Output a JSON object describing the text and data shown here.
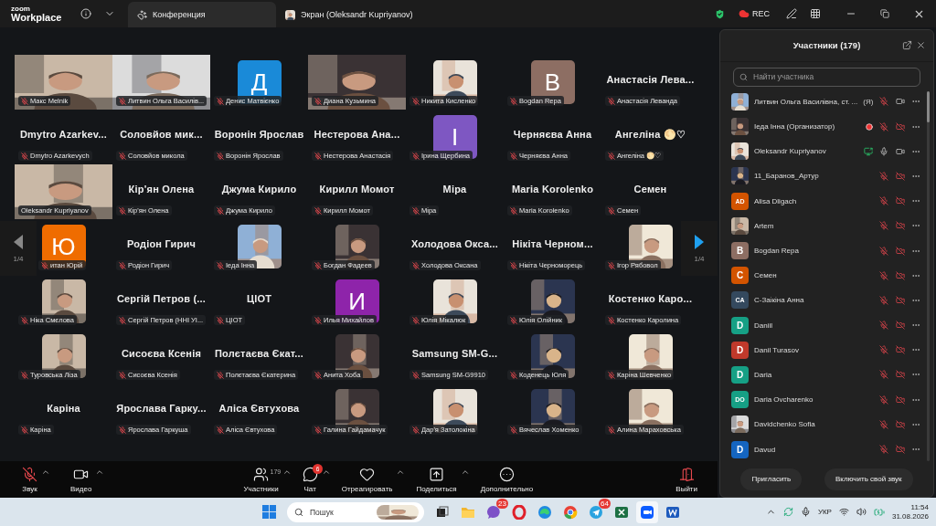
{
  "titlebar": {
    "logo_top": "zoom",
    "logo_bottom": "Workplace",
    "rec": "REC",
    "tabs": [
      {
        "label": "Конференция",
        "kind": "meeting",
        "selected": true
      },
      {
        "label": "Экран (Oleksandr Kupriyanov)",
        "kind": "screen",
        "selected": false
      }
    ]
  },
  "gallery": {
    "page_left": "1/4",
    "page_right": "1/4",
    "tiles": [
      {
        "kind": "video_full",
        "name": "Макс Melnik",
        "muted": true,
        "speaking": false
      },
      {
        "kind": "video_full",
        "name": "Литвин Ольга Василів...",
        "muted": true,
        "speaking": false
      },
      {
        "kind": "avatar",
        "letter": "Д",
        "color": "#1a8ad8",
        "name": "Денис Матвієнко",
        "muted": true,
        "speaking": false
      },
      {
        "kind": "video_full",
        "name": "Диана Кузьмина",
        "muted": true,
        "speaking": false
      },
      {
        "kind": "video",
        "name": "Никита Кисленко",
        "muted": true,
        "speaking": false
      },
      {
        "kind": "avatar",
        "letter": "B",
        "color": "#8d6e63",
        "name": "Bogdan Repa",
        "muted": true,
        "speaking": false
      },
      {
        "kind": "name",
        "title": "Анастасія Лева...",
        "name": "Анастасія Леванда",
        "muted": true,
        "speaking": false
      },
      {
        "kind": "name",
        "title": "Dmytro Azarkev...",
        "name": "Dmytro Azarkevych",
        "muted": true,
        "speaking": false
      },
      {
        "kind": "name",
        "title": "Соловйов мик...",
        "name": "Соловйов микола",
        "muted": true,
        "speaking": false
      },
      {
        "kind": "name",
        "title": "Воронін Ярослав",
        "name": "Воронін Ярослав",
        "muted": true,
        "speaking": false
      },
      {
        "kind": "name",
        "title": "Нестерова Ана...",
        "name": "Нестерова Анастасія",
        "muted": true,
        "speaking": false
      },
      {
        "kind": "avatar",
        "letter": "I",
        "color": "#7e57c2",
        "name": "Ірина Щербина",
        "muted": true,
        "speaking": false
      },
      {
        "kind": "name",
        "title": "Черняєва Анна",
        "name": "Черняєва Анна",
        "muted": true,
        "speaking": false
      },
      {
        "kind": "name",
        "title": "Ангеліна 🌕♡",
        "name": "Ангеліна 🌕♡",
        "muted": true,
        "speaking": false
      },
      {
        "kind": "video_full",
        "name": "Oleksandr Kupriyanov",
        "muted": false,
        "speaking": true
      },
      {
        "kind": "name",
        "title": "Кір'ян Олена",
        "name": "Кір'ян Олена",
        "muted": true,
        "speaking": false
      },
      {
        "kind": "name",
        "title": "Джума Кирило",
        "name": "Джума Кирило",
        "muted": true,
        "speaking": false
      },
      {
        "kind": "name",
        "title": "Кирилл Момот",
        "name": "Кирилл Момот",
        "muted": true,
        "speaking": false
      },
      {
        "kind": "name",
        "title": "Міра",
        "name": "Міра",
        "muted": true,
        "speaking": false
      },
      {
        "kind": "name",
        "title": "Maria Korolenko",
        "name": "Maria Korolenko",
        "muted": true,
        "speaking": false
      },
      {
        "kind": "name",
        "title": "Семен",
        "name": "Семен",
        "muted": true,
        "speaking": false
      },
      {
        "kind": "avatar",
        "letter": "Ю",
        "color": "#ef6c00",
        "name": "итан Юрій",
        "muted": true,
        "speaking": false
      },
      {
        "kind": "name",
        "title": "Родіон Гирич",
        "name": "Родіон Гирич",
        "muted": true,
        "speaking": false
      },
      {
        "kind": "video",
        "name": "Іеда Інна",
        "muted": true,
        "speaking": false
      },
      {
        "kind": "video",
        "name": "Богдан Фадеев",
        "muted": true,
        "speaking": false
      },
      {
        "kind": "name",
        "title": "Холодова Окса...",
        "name": "Холодова Оксана",
        "muted": true,
        "speaking": false
      },
      {
        "kind": "name",
        "title": "Нікіта Черном...",
        "name": "Нікіта Черноморець",
        "muted": true,
        "speaking": false
      },
      {
        "kind": "video",
        "name": "Ігор Рябовол",
        "muted": true,
        "speaking": false
      },
      {
        "kind": "video",
        "name": "Ніка Смєлова",
        "muted": true,
        "speaking": false
      },
      {
        "kind": "name",
        "title": "Сергій Петров (...",
        "name": "Сергій Петров (ННІ УІ...",
        "muted": true,
        "speaking": false
      },
      {
        "kind": "name",
        "title": "ЦІОТ",
        "name": "ЦІОТ",
        "muted": true,
        "speaking": false
      },
      {
        "kind": "avatar",
        "letter": "И",
        "color": "#8e24aa",
        "name": "Илья Михайлов",
        "muted": true,
        "speaking": false
      },
      {
        "kind": "video",
        "name": "Юлія Мікалюк",
        "muted": true,
        "speaking": false
      },
      {
        "kind": "video",
        "name": "Юлія Олійник",
        "muted": true,
        "speaking": false
      },
      {
        "kind": "name",
        "title": "Костенко Каро...",
        "name": "Костенко Каролина",
        "muted": true,
        "speaking": false
      },
      {
        "kind": "video",
        "name": "Туровська Ліза",
        "muted": true,
        "speaking": false
      },
      {
        "kind": "name",
        "title": "Сисоєва Ксенія",
        "name": "Сисоєва Ксенія",
        "muted": true,
        "speaking": false
      },
      {
        "kind": "name",
        "title": "Полєтаєва Єкат...",
        "name": "Полєтаєва Єкатерина",
        "muted": true,
        "speaking": false
      },
      {
        "kind": "video",
        "name": "Анита Хоба",
        "muted": true,
        "speaking": false
      },
      {
        "kind": "name",
        "title": "Samsung SM-G...",
        "name": "Samsung SM-G9910",
        "muted": true,
        "speaking": false
      },
      {
        "kind": "video",
        "name": "Коденець Юля",
        "muted": true,
        "speaking": false
      },
      {
        "kind": "video",
        "name": "Каріна Шевченко",
        "muted": true,
        "speaking": false
      },
      {
        "kind": "name",
        "title": "Каріна",
        "name": "Каріна",
        "muted": true,
        "speaking": false
      },
      {
        "kind": "name",
        "title": "Ярослава Гарку...",
        "name": "Ярослава Гаркуша",
        "muted": true,
        "speaking": false
      },
      {
        "kind": "name",
        "title": "Аліса Євтухова",
        "name": "Аліса Євтухова",
        "muted": true,
        "speaking": false
      },
      {
        "kind": "video",
        "name": "Галина Гайдамачук",
        "muted": true,
        "speaking": false
      },
      {
        "kind": "video",
        "name": "Дар'я Затолокіна",
        "muted": true,
        "speaking": false
      },
      {
        "kind": "video",
        "name": "Вячеслав Хоменко",
        "muted": true,
        "speaking": false
      },
      {
        "kind": "video",
        "name": "Алина Мараховська",
        "muted": true,
        "speaking": false
      }
    ]
  },
  "participants": {
    "title": "Участники (179)",
    "search": {
      "placeholder": "Найти участника"
    },
    "rows": [
      {
        "name": "Литвин Ольга Василівна, ст. ...",
        "tag": "(Я)",
        "recording": false,
        "sharing": false,
        "mic_muted": true,
        "camera_off": false
      },
      {
        "name": "Іеда Інна (Организатор)",
        "recording": true,
        "sharing": false,
        "mic_muted": true,
        "camera_off": true
      },
      {
        "name": "Oleksandr Kupriyanov",
        "recording": false,
        "sharing": true,
        "mic_muted": false,
        "camera_off": false
      },
      {
        "name": "11_Баранов_Артур",
        "recording": false,
        "sharing": false,
        "mic_muted": true,
        "camera_off": true
      },
      {
        "avatar": {
          "kind": "initials",
          "text": "AD",
          "color": "#d35400"
        },
        "name": "Alisa Dligach",
        "recording": false,
        "sharing": false,
        "mic_muted": true,
        "camera_off": true
      },
      {
        "name": "Artem",
        "recording": false,
        "sharing": false,
        "mic_muted": true,
        "camera_off": true
      },
      {
        "avatar": {
          "kind": "initials",
          "text": "B",
          "color": "#8d6e63"
        },
        "name": "Bogdan Repa",
        "recording": false,
        "sharing": false,
        "mic_muted": true,
        "camera_off": true
      },
      {
        "avatar": {
          "kind": "initials",
          "text": "С",
          "color": "#d35400"
        },
        "name": "Семен",
        "recording": false,
        "sharing": false,
        "mic_muted": true,
        "camera_off": true
      },
      {
        "avatar": {
          "kind": "initials",
          "text": "CA",
          "color": "#34495e"
        },
        "name": "С-Заікіна Анна",
        "recording": false,
        "sharing": false,
        "mic_muted": true,
        "camera_off": true
      },
      {
        "avatar": {
          "kind": "initials",
          "text": "D",
          "color": "#16a085"
        },
        "name": "Daniil",
        "recording": false,
        "sharing": false,
        "mic_muted": true,
        "camera_off": true
      },
      {
        "avatar": {
          "kind": "initials",
          "text": "D",
          "color": "#c0392b"
        },
        "name": "Danil Turasov",
        "recording": false,
        "sharing": false,
        "mic_muted": true,
        "camera_off": true
      },
      {
        "avatar": {
          "kind": "initials",
          "text": "D",
          "color": "#16a085"
        },
        "name": "Daria",
        "recording": false,
        "sharing": false,
        "mic_muted": true,
        "camera_off": true
      },
      {
        "avatar": {
          "kind": "initials",
          "text": "DO",
          "color": "#16a085"
        },
        "name": "Daria Ovcharenko",
        "recording": false,
        "sharing": false,
        "mic_muted": true,
        "camera_off": true
      },
      {
        "name": "Davidchenko Sofia",
        "recording": false,
        "sharing": false,
        "mic_muted": true,
        "camera_off": true
      },
      {
        "avatar": {
          "kind": "initials",
          "text": "D",
          "color": "#1565c0"
        },
        "name": "Davud",
        "recording": false,
        "sharing": false,
        "mic_muted": true,
        "camera_off": true
      }
    ],
    "buttons": [
      "Пригласить",
      "Включить свой звук"
    ]
  },
  "toolbar": {
    "items": [
      {
        "kind": "audio",
        "label": "Звук",
        "muted": true,
        "caret": true
      },
      {
        "kind": "video",
        "label": "Видео",
        "caret": true
      },
      {
        "kind": "participants",
        "label": "Участники",
        "count": "179",
        "caret": true
      },
      {
        "kind": "chat",
        "label": "Чат",
        "badge": "6",
        "caret": true
      },
      {
        "kind": "react",
        "label": "Отреагировать",
        "caret": true
      },
      {
        "kind": "share",
        "label": "Поделиться",
        "caret": true
      },
      {
        "kind": "more",
        "label": "Дополнительно",
        "caret": false
      },
      {
        "kind": "leave",
        "label": "Выйти",
        "caret": false
      }
    ]
  },
  "taskbar": {
    "search_placeholder": "Пошук",
    "apps": [
      {
        "kind": "taskview",
        "selected": false
      },
      {
        "kind": "folder",
        "selected": false
      },
      {
        "kind": "viber",
        "badge": "23",
        "selected": false
      },
      {
        "kind": "opera",
        "selected": false
      },
      {
        "kind": "edge",
        "selected": false
      },
      {
        "kind": "chrome",
        "selected": false
      },
      {
        "kind": "telegram",
        "badge": "64",
        "selected": false
      },
      {
        "kind": "excel",
        "selected": false
      },
      {
        "kind": "zoom",
        "selected": true
      },
      {
        "kind": "word",
        "selected": false
      }
    ],
    "language": "УКР",
    "time": "11:54",
    "date": "31.08.2026"
  }
}
